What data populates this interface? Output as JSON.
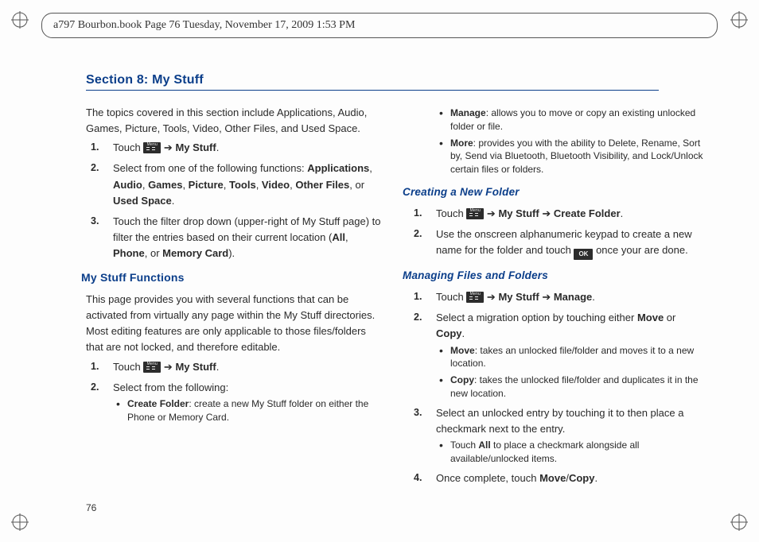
{
  "frame_header": "a797 Bourbon.book  Page 76  Tuesday, November 17, 2009  1:53 PM",
  "page_number": "76",
  "section_title": "Section 8: My Stuff",
  "left": {
    "intro": "The topics covered in this section include Applications, Audio, Games, Picture, Tools, Video, Other Files, and Used Space.",
    "ol1": {
      "i1_a": "Touch ",
      "i1_b": " ➔ ",
      "i1_c": "My Stuff",
      "i1_d": ".",
      "i2_a": "Select from one of the following functions: ",
      "i2_b": "Applications",
      "i2_c": ", ",
      "i2_d": "Audio",
      "i2_e": ", ",
      "i2_f": "Games",
      "i2_g": ", ",
      "i2_h": "Picture",
      "i2_i": ", ",
      "i2_j": "Tools",
      "i2_k": ", ",
      "i2_l": "Video",
      "i2_m": ", ",
      "i2_n": "Other Files",
      "i2_o": ", or ",
      "i2_p": "Used Space",
      "i2_q": ".",
      "i3_a": "Touch the filter drop down (upper-right of My Stuff page) to filter the entries based on their current location (",
      "i3_b": "All",
      "i3_c": ", ",
      "i3_d": "Phone",
      "i3_e": ", or ",
      "i3_f": "Memory Card",
      "i3_g": ")."
    },
    "h2": "My Stuff Functions",
    "p2": "This page provides you with several functions that can be activated from virtually any page within the My Stuff directories. Most editing features are only applicable to those files/folders that are not locked, and therefore editable.",
    "ol2": {
      "i1_a": "Touch ",
      "i1_b": " ➔ ",
      "i1_c": "My Stuff",
      "i1_d": ".",
      "i2": "Select from the following:"
    },
    "bul": {
      "b1a": "Create Folder",
      "b1b": ": create a new My Stuff folder on either the Phone or Memory Card."
    }
  },
  "right": {
    "bul_top": {
      "b1a": "Manage",
      "b1b": ": allows you to move or copy an existing unlocked folder or file.",
      "b2a": "More",
      "b2b": ": provides you with the ability to Delete, Rename, Sort by, Send via Bluetooth, Bluetooth Visibility, and Lock/Unlock certain files or folders."
    },
    "h_create": "Creating a New Folder",
    "ol_create": {
      "i1_a": "Touch ",
      "i1_b": " ➔ ",
      "i1_c": "My Stuff",
      "i1_d": " ➔ ",
      "i1_e": "Create Folder",
      "i1_f": ".",
      "i2_a": "Use the onscreen alphanumeric keypad to create a new name for the folder and touch ",
      "i2_b": " once your are done."
    },
    "h_manage": "Managing Files and Folders",
    "ol_manage": {
      "i1_a": "Touch ",
      "i1_b": " ➔ ",
      "i1_c": "My Stuff",
      "i1_d": " ➔ ",
      "i1_e": "Manage",
      "i1_f": ".",
      "i2_a": "Select a migration option by touching either ",
      "i2_b": "Move",
      "i2_c": " or ",
      "i2_d": "Copy",
      "i2_e": ".",
      "bul2": {
        "b1a": "Move",
        "b1b": ": takes an unlocked file/folder and moves it to a new location.",
        "b2a": "Copy",
        "b2b": ": takes the unlocked file/folder and duplicates it in the new location."
      },
      "i3": "Select an unlocked entry by touching it to then place a checkmark next to the entry.",
      "bul3": {
        "b1a": "Touch ",
        "b1b": "All",
        "b1c": " to place a checkmark alongside all available/unlocked items."
      },
      "i4_a": "Once complete, touch ",
      "i4_b": "Move",
      "i4_c": "/",
      "i4_d": "Copy",
      "i4_e": "."
    }
  }
}
